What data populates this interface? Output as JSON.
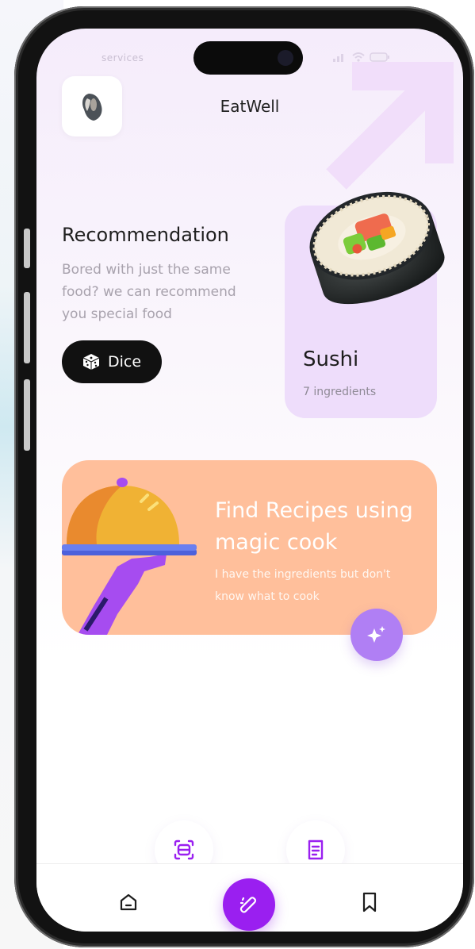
{
  "status_bar": {
    "carrier": "services"
  },
  "header": {
    "title": "EatWell",
    "logo_icon": "chef-icon"
  },
  "recommendation": {
    "title": "Recommendation",
    "subtitle": "Bored with just the same food? we can recommend you special food",
    "dice_button": "Dice",
    "dice_icon": "dice-icon"
  },
  "featured_food": {
    "name": "Sushi",
    "ingredients": "7 ingredients"
  },
  "magic_cook": {
    "title": "Find Recipes using magic cook",
    "subtitle": "I have the ingredients but don't know what to cook",
    "action_icon": "sparkle-icon"
  },
  "floating_actions": [
    {
      "icon": "scan-icon"
    },
    {
      "icon": "receipt-icon"
    }
  ],
  "tab_bar": [
    {
      "icon": "home-icon"
    },
    {
      "icon": "magic-wand-icon",
      "active": true
    },
    {
      "icon": "bookmark-icon"
    }
  ],
  "colors": {
    "accent": "#9a1ff0",
    "card_purple": "#eeddfb",
    "card_orange": "#ffbf9b",
    "fab_purple": "#b07ff4"
  }
}
